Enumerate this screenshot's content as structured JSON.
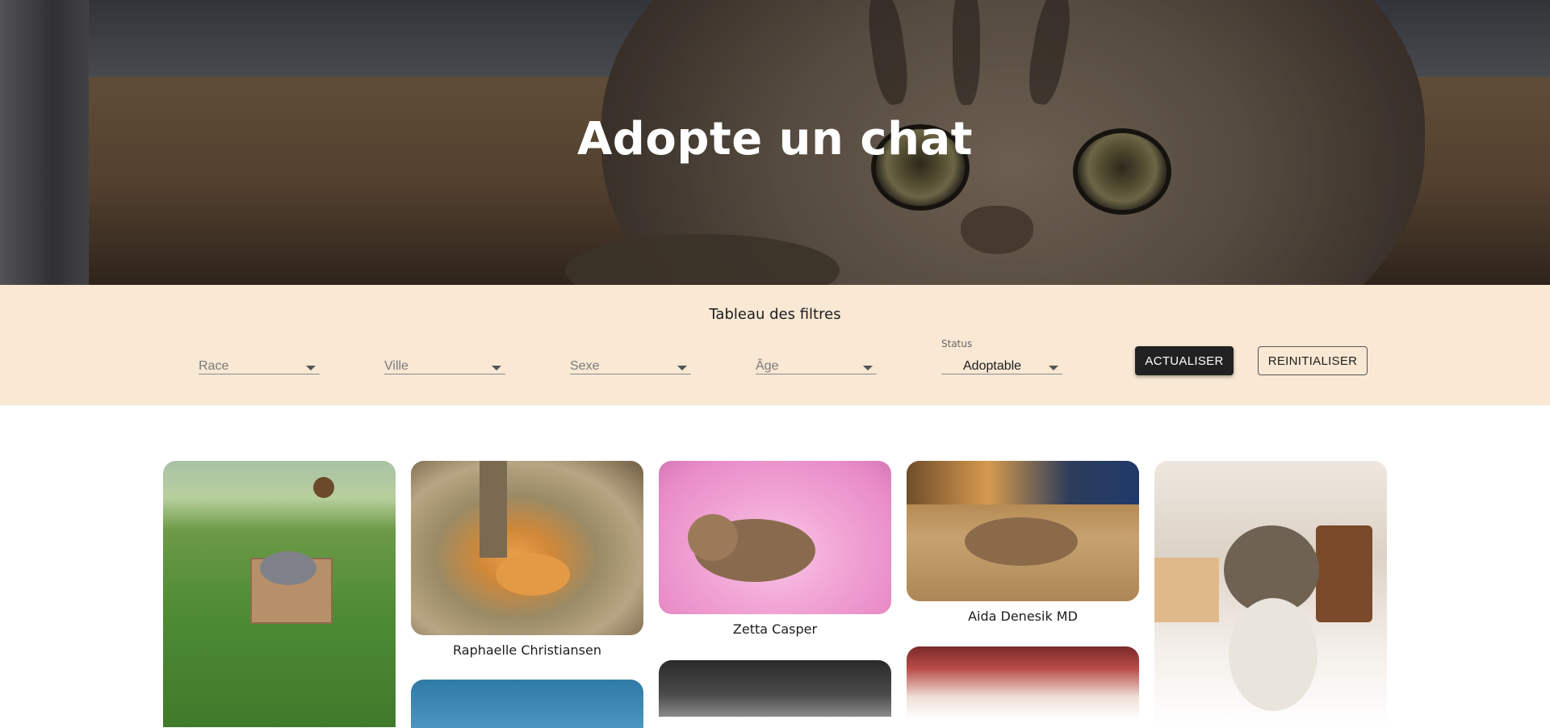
{
  "hero": {
    "title": "Adopte un chat"
  },
  "filters": {
    "title": "Tableau des filtres",
    "race_placeholder": "Race",
    "ville_placeholder": "Ville",
    "sexe_placeholder": "Sexe",
    "age_placeholder": "Âge",
    "status_label": "Status",
    "status_value": "Adoptable",
    "refresh_label": "ACTUALISER",
    "reset_label": "REINITIALISER"
  },
  "cats": [
    {
      "name": ""
    },
    {
      "name": "Raphaelle Christiansen"
    },
    {
      "name": "Zetta Casper"
    },
    {
      "name": "Aida Denesik MD"
    },
    {
      "name": ""
    }
  ],
  "colors": {
    "filter_background": "#f8e8d4",
    "primary_button": "#212121"
  }
}
